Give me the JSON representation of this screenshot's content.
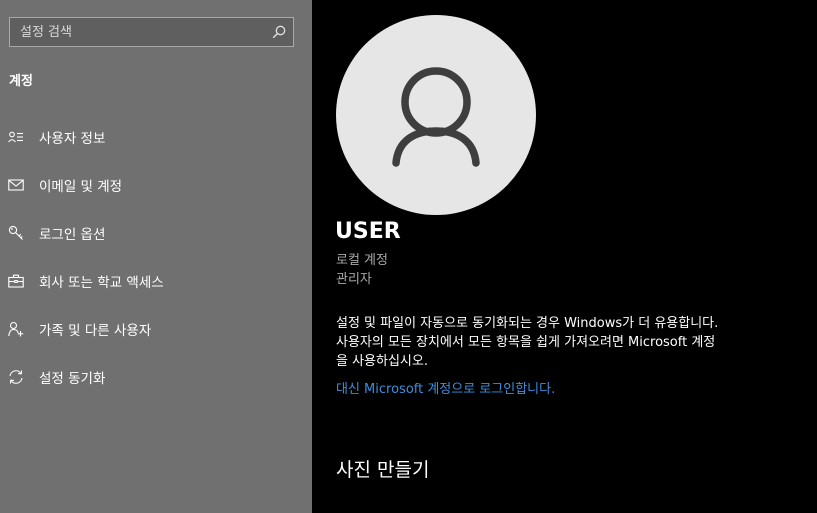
{
  "sidebar": {
    "search": {
      "placeholder": "설정 검색",
      "icon": "search-icon"
    },
    "section_title": "계정",
    "items": [
      {
        "label": "사용자 정보",
        "icon": "user-info-icon"
      },
      {
        "label": "이메일 및 계정",
        "icon": "mail-icon"
      },
      {
        "label": "로그인 옵션",
        "icon": "key-icon"
      },
      {
        "label": "회사 또는 학교 액세스",
        "icon": "briefcase-icon"
      },
      {
        "label": "가족 및 다른 사용자",
        "icon": "person-add-icon"
      },
      {
        "label": "설정 동기화",
        "icon": "sync-icon"
      }
    ]
  },
  "main": {
    "avatar_icon": "user-avatar-icon",
    "user_name": "USER",
    "account_type": "로컬 계정",
    "account_role": "관리자",
    "info_line1": "설정 및 파일이 자동으로 동기화되는 경우 Windows가 더 유용합니다.",
    "info_line2": "사용자의 모든 장치에서 모든 항목을 쉽게 가져오려면 Microsoft 계정",
    "info_line3": "을 사용하십시오.",
    "ms_signin_link": "대신 Microsoft 계정으로 로그인합니다.",
    "make_photo_heading": "사진 만들기"
  },
  "colors": {
    "sidebar_bg": "#707070",
    "main_bg": "#000000",
    "link": "#3a8fde",
    "avatar_bg": "#e6e6e6"
  }
}
